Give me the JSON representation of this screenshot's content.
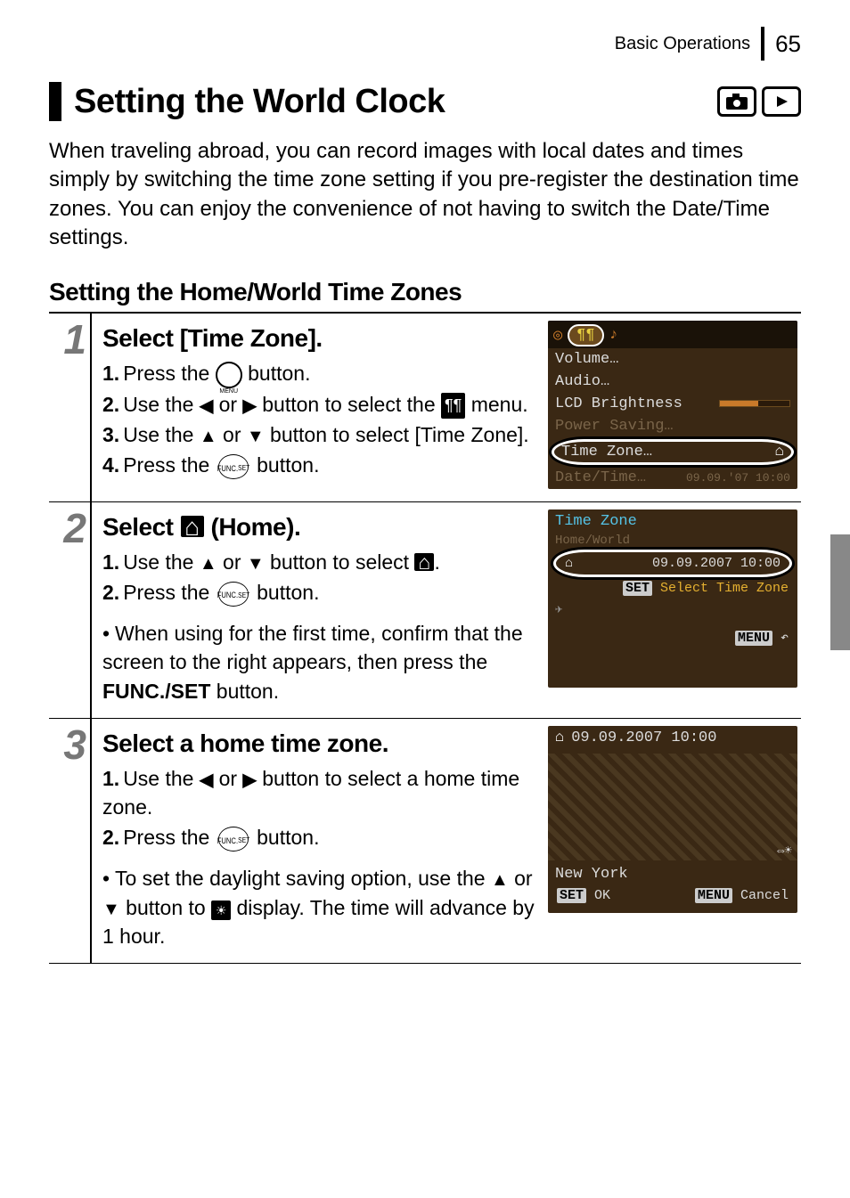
{
  "header": {
    "section": "Basic Operations",
    "page_number": "65"
  },
  "h1": "Setting the World Clock",
  "intro": "When traveling abroad, you can record images with local dates and times simply by switching the time zone setting if you pre-register the destination time zones. You can enjoy the convenience of not having to switch the Date/Time settings.",
  "h2": "Setting the Home/World Time Zones",
  "icons": {
    "camera": "camera-mode-icon",
    "playback": "playback-mode-icon",
    "menu_button": "MENU",
    "func_top": "FUNC.",
    "func_bottom": "SET",
    "wrench": "🛠",
    "home": "⌂",
    "dst": "☀",
    "arrow_left": "◀",
    "arrow_right": "▶",
    "arrow_up": "▲",
    "arrow_down": "▼"
  },
  "steps": [
    {
      "num": "1",
      "title": "Select [Time Zone].",
      "lines": [
        {
          "n": "1.",
          "pre": "Press the ",
          "icon": "menu",
          "post": " button."
        },
        {
          "n": "2.",
          "pre": "Use the ",
          "icon": "lr",
          "post": " button to select the ",
          "icon2": "wrench",
          "tail": " menu."
        },
        {
          "n": "3.",
          "pre": "Use the ",
          "icon": "ud",
          "post": " button to select [Time Zone]."
        },
        {
          "n": "4.",
          "pre": "Press the ",
          "icon": "func",
          "post": " button."
        }
      ],
      "screen": {
        "menu_items": [
          "Volume…",
          "Audio…",
          "LCD Brightness",
          "Power Saving…"
        ],
        "highlighted": "Time Zone…",
        "after": "Date/Time…",
        "after_val": "09.09.'07 10:00"
      }
    },
    {
      "num": "2",
      "title_pre": "Select ",
      "title_post": " (Home).",
      "lines": [
        {
          "n": "1.",
          "pre": "Use the ",
          "icon": "ud",
          "post": " button to select ",
          "icon2": "home",
          "tail": "."
        },
        {
          "n": "2.",
          "pre": "Press the ",
          "icon": "func",
          "post": " button."
        }
      ],
      "note": "When using for the first time, confirm that the screen to the right appears, then press the FUNC./SET button.",
      "note_bold": "FUNC./SET",
      "screen": {
        "title": "Time Zone",
        "tabs": "Home/World",
        "date": "09.09.2007 10:00",
        "prompt_label": "SET",
        "prompt": "Select Time Zone",
        "menu_label": "MENU",
        "back_glyph": "↶"
      }
    },
    {
      "num": "3",
      "title": "Select a home time zone.",
      "lines": [
        {
          "n": "1.",
          "pre": "Use the ",
          "icon": "lr",
          "post": " button to select a home time zone."
        },
        {
          "n": "2.",
          "pre": "Press the ",
          "icon": "func",
          "post": " button."
        }
      ],
      "note_pre": "To set the daylight saving option, use the ",
      "note_mid": " button to ",
      "note_post": " display. The time will advance by 1 hour.",
      "screen": {
        "date": "09.09.2007 10:00",
        "city": "New York",
        "ok_label": "SET",
        "ok": "OK",
        "cancel_label": "MENU",
        "cancel": "Cancel",
        "dst": "⇔☀"
      }
    }
  ]
}
